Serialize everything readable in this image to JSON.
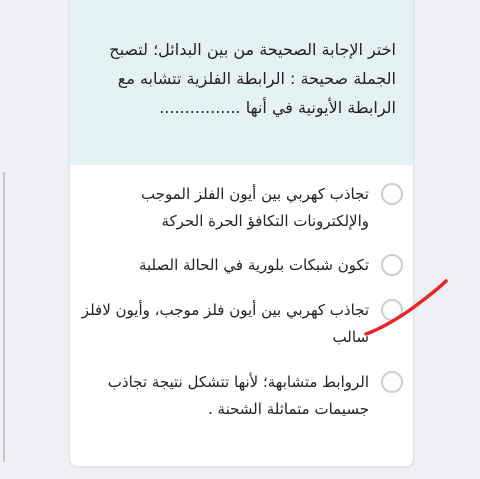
{
  "question": {
    "text": "اختر الإجابة الصحيحة من بين البدائل؛ لتصبح الجملة صحيحة : الرابطة الفلزية تتشابه مع الرابطة الأيونية في أنها ................"
  },
  "options": [
    {
      "label": "تجاذب كهربي بين أيون الفلز الموجب والإلكترونات التكافؤ الحرة الحركة",
      "selected": false
    },
    {
      "label": "تكون شبكات بلورية في الحالة الصلبة",
      "selected": false
    },
    {
      "label": "تجاذب كهربي بين أيون فلز موجب، وأيون لافلز سالب",
      "selected": false
    },
    {
      "label": "الروابط متشابهة؛ لأنها تتشكل نتيجة تجاذب جسيمات متماثلة الشحنة .",
      "selected": false
    }
  ],
  "annotation": {
    "color": "#e8262a"
  }
}
